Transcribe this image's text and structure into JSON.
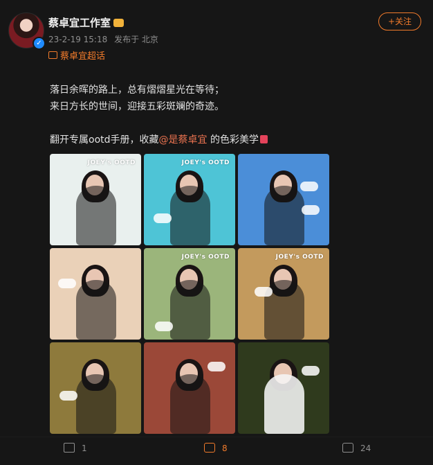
{
  "post": {
    "author": "蔡卓宜工作室",
    "time": "23-2-19 15:18",
    "location": "发布于 北京",
    "follow_label": "+关注",
    "supertopic": "蔡卓宜超话",
    "lines": [
      "落日余晖的路上，总有熠熠星光在等待；",
      "来日方长的世间，迎接五彩斑斓的奇迹。"
    ],
    "line3_prefix": "翻开专属ootd手册，收藏",
    "mention": "@是蔡卓宜",
    "line3_suffix": " 的色彩美学"
  },
  "gallery": [
    {
      "label": "JOEY's OOTD",
      "bg": "#e9f0ee"
    },
    {
      "label": "JOEY's OOTD",
      "bg": "#4ec4d6"
    },
    {
      "label": "",
      "bg": "#4b8ed8"
    },
    {
      "label": "",
      "bg": "#ead1b8"
    },
    {
      "label": "JOEY's OOTD",
      "bg": "#9bb57b"
    },
    {
      "label": "JOEY's OOTD",
      "bg": "#c39a5d"
    },
    {
      "label": "",
      "bg": "#8e7a3c"
    },
    {
      "label": "",
      "bg": "#9b4838"
    },
    {
      "label": "",
      "bg": "#2f3a1d"
    }
  ],
  "footer": {
    "share_count": "1",
    "comment_count": "8",
    "like_count": "24"
  }
}
